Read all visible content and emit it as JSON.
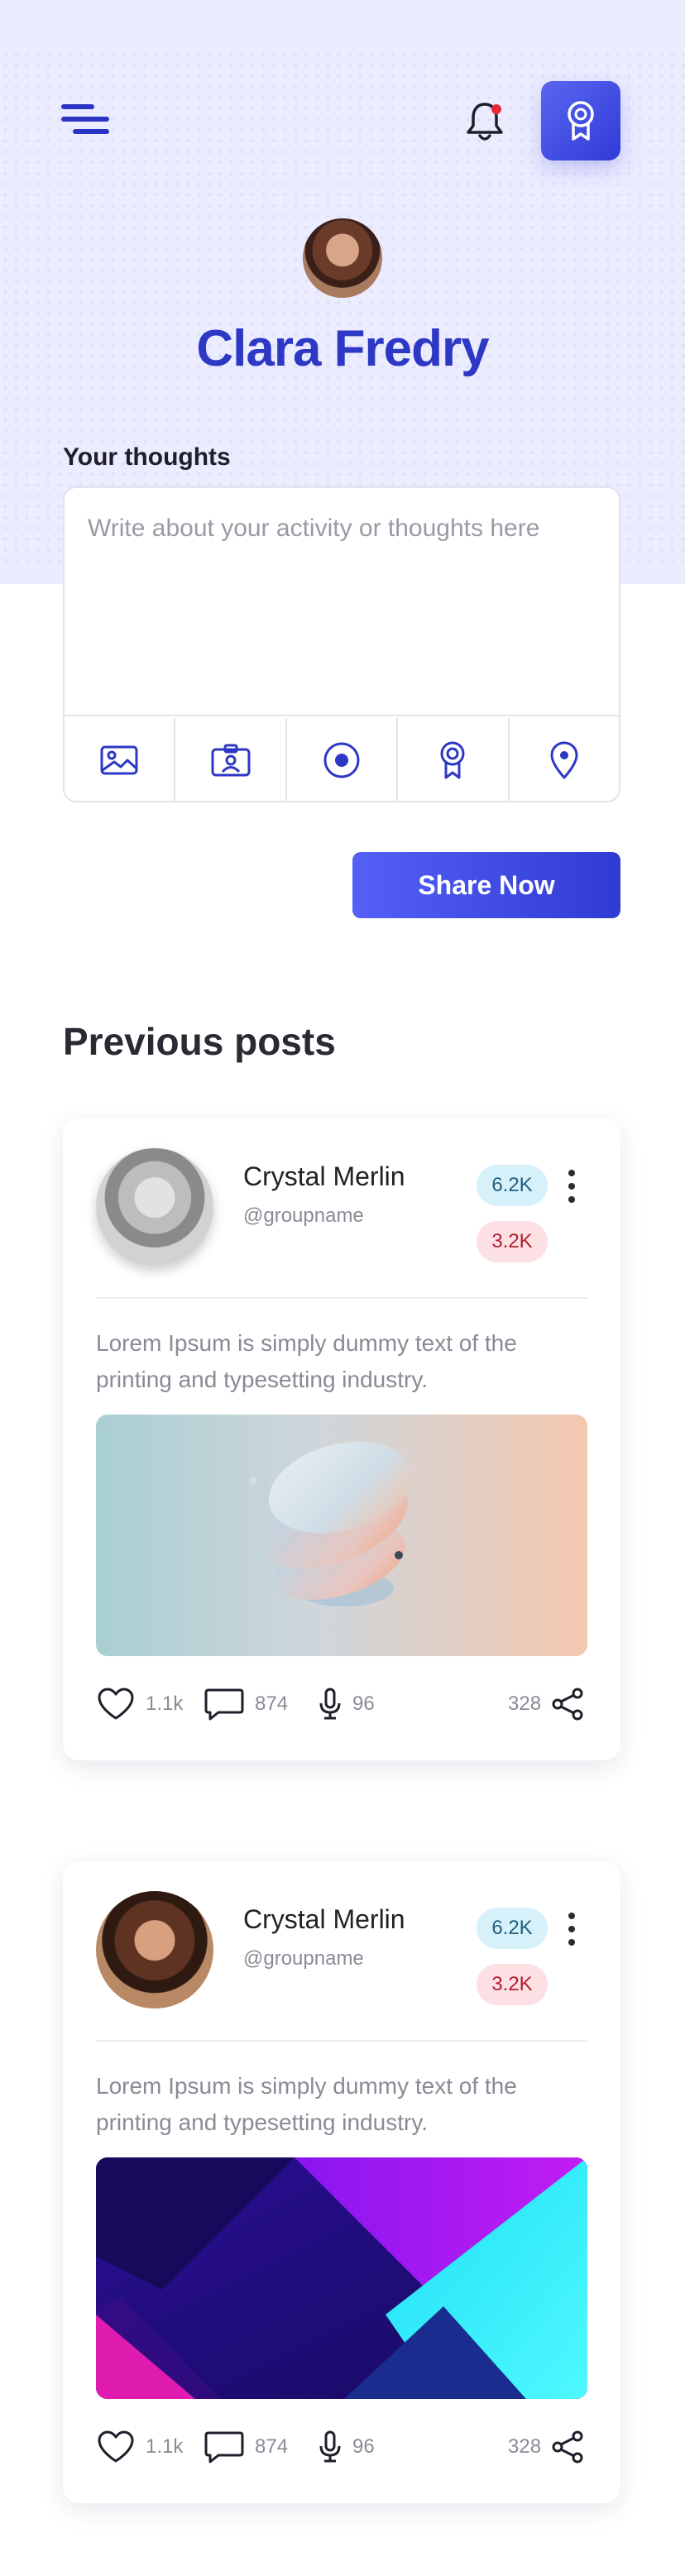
{
  "header": {
    "profile_name": "Clara Fredry"
  },
  "composer": {
    "label": "Your thoughts",
    "placeholder": "Write about your activity or thoughts here",
    "tools": [
      "image-icon",
      "contact-card-icon",
      "record-icon",
      "award-icon",
      "location-pin-icon"
    ],
    "share_label": "Share Now"
  },
  "feed": {
    "title": "Previous posts",
    "posts": [
      {
        "author": "Crystal Merlin",
        "handle": "@groupname",
        "stat_blue": "6.2K",
        "stat_red": "3.2K",
        "text": "Lorem Ipsum is simply dummy text of the printing and typesetting industry.",
        "likes": "1.1k",
        "comments": "874",
        "voice": "96",
        "shares": "328"
      },
      {
        "author": "Crystal Merlin",
        "handle": "@groupname",
        "stat_blue": "6.2K",
        "stat_red": "3.2K",
        "text": "Lorem Ipsum is simply dummy text of the printing and typesetting industry.",
        "likes": "1.1k",
        "comments": "874",
        "voice": "96",
        "shares": "328"
      }
    ]
  },
  "colors": {
    "accent": "#2d38c4",
    "hero_bg": "#ececff",
    "notification_dot": "#e8283a",
    "pill_blue_bg": "#d7f1fa",
    "pill_red_bg": "#fde0e3"
  }
}
